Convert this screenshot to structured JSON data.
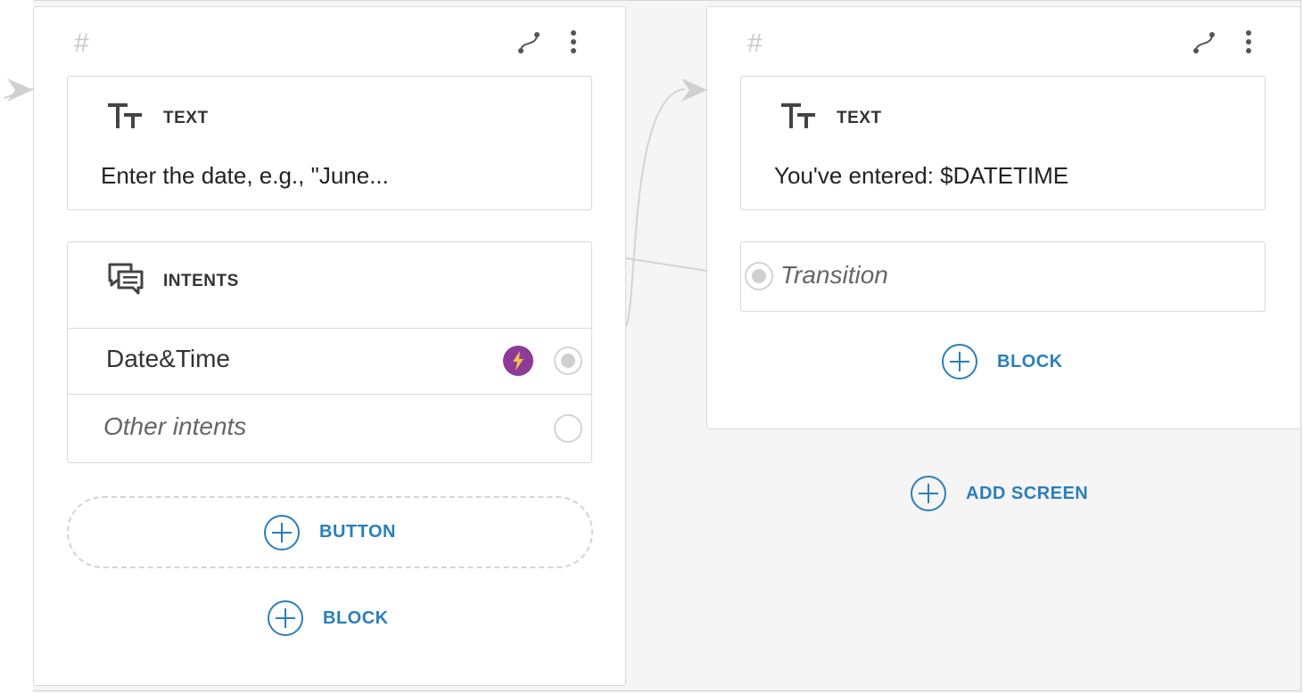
{
  "colors": {
    "accent": "#2a7fba",
    "badge": "#8e3a97",
    "bolt": "#f7c04b"
  },
  "screens": [
    {
      "hash": "#",
      "text_block": {
        "title": "TEXT",
        "body": "Enter the date, e.g., \"June..."
      },
      "intents_block": {
        "title": "INTENTS",
        "items": [
          {
            "label": "Date&Time",
            "badge_icon": "bolt-icon"
          },
          {
            "label": "Other intents"
          }
        ]
      },
      "add_button_label": "BUTTON",
      "add_block_label": "BLOCK"
    },
    {
      "hash": "#",
      "text_block": {
        "title": "TEXT",
        "body": "You've entered: $DATETIME"
      },
      "transition_block": {
        "label": "Transition"
      },
      "add_block_label": "BLOCK"
    }
  ],
  "add_screen_label": "ADD SCREEN"
}
